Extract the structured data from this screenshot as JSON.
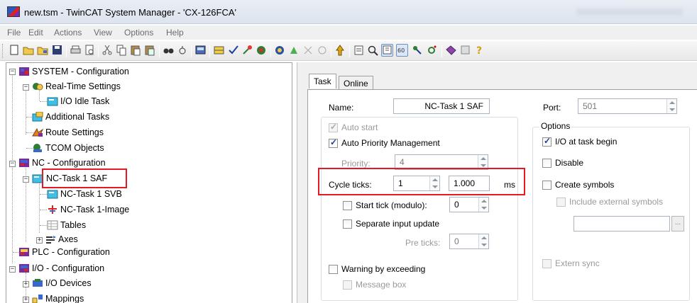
{
  "window": {
    "title": "new.tsm - TwinCAT System Manager - 'CX-126FCA'"
  },
  "menu": [
    "File",
    "Edit",
    "Actions",
    "View",
    "Options",
    "Help"
  ],
  "toolbar": {
    "icons": [
      "new-icon",
      "open-icon",
      "open-from-target-icon",
      "save-icon",
      "print-icon",
      "print-preview-icon",
      "cut-icon",
      "copy-icon",
      "paste-icon",
      "paste-with-links-icon",
      "find-icon",
      "find-next-icon",
      "activate-icon",
      "generate-mappings-icon",
      "check-icon",
      "activate-config-icon",
      "set-run-mode-icon",
      "set-config-mode-icon",
      "reload-devices-icon",
      "scan-icon",
      "toggle-free-run-icon",
      "force-icon",
      "show-online-data-icon",
      "scope-icon",
      "zoom-icon",
      "show-sub-items-icon",
      "target-browser-icon",
      "choose-target-icon",
      "set-target-icon",
      "security-icon",
      "info-icon",
      "help-icon"
    ]
  },
  "tree": {
    "items": [
      {
        "label": "SYSTEM - Configuration",
        "icon": "system-config-icon"
      },
      {
        "label": "Real-Time Settings",
        "icon": "realtime-settings-icon"
      },
      {
        "label": "I/O Idle Task",
        "icon": "task-icon"
      },
      {
        "label": "Additional Tasks",
        "icon": "additional-tasks-icon"
      },
      {
        "label": "Route Settings",
        "icon": "route-settings-icon"
      },
      {
        "label": "TCOM Objects",
        "icon": "tcom-objects-icon"
      },
      {
        "label": "NC - Configuration",
        "icon": "nc-config-icon"
      },
      {
        "label": "NC-Task 1 SAF",
        "icon": "task-icon"
      },
      {
        "label": "NC-Task 1 SVB",
        "icon": "task-icon"
      },
      {
        "label": "NC-Task 1-Image",
        "icon": "image-icon"
      },
      {
        "label": "Tables",
        "icon": "tables-icon"
      },
      {
        "label": "Axes",
        "icon": "axes-icon"
      },
      {
        "label": "PLC - Configuration",
        "icon": "plc-config-icon"
      },
      {
        "label": "I/O - Configuration",
        "icon": "io-config-icon"
      },
      {
        "label": "I/O Devices",
        "icon": "io-devices-icon"
      },
      {
        "label": "Mappings",
        "icon": "mappings-icon"
      }
    ]
  },
  "tabs": [
    "Task",
    "Online"
  ],
  "task": {
    "name_label": "Name:",
    "name_value": "NC-Task 1 SAF",
    "port_label": "Port:",
    "port_value": "501",
    "auto_start": "Auto start",
    "auto_priority": "Auto Priority Management",
    "priority_label": "Priority:",
    "priority_value": "4",
    "cycle_ticks_label": "Cycle ticks:",
    "cycle_ticks_value": "1",
    "cycle_time_value": "1.000",
    "cycle_unit": "ms",
    "start_tick": "Start tick (modulo):",
    "start_tick_value": "0",
    "separate_input": "Separate input update",
    "pre_ticks_label": "Pre ticks:",
    "pre_ticks_value": "0",
    "warning": "Warning by exceeding",
    "message_box": "Message box"
  },
  "options": {
    "title": "Options",
    "io_at_begin": "I/O at task begin",
    "disable": "Disable",
    "create_symbols": "Create symbols",
    "include_external": "Include external symbols",
    "ellipsis": "...",
    "extern_sync": "Extern sync"
  }
}
